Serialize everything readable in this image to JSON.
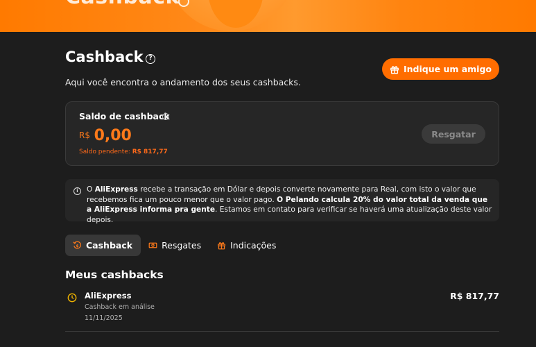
{
  "banner": {
    "title": "Cashback"
  },
  "header": {
    "title": "Cashback",
    "subtitle": "Aqui você encontra o andamento dos seus cashbacks.",
    "invite_label": "Indique um amigo"
  },
  "balance_card": {
    "label": "Saldo de cashback",
    "currency": "R$",
    "value": "0,00",
    "pending_label": "Saldo pendente:",
    "pending_value": "R$ 817,77",
    "redeem_label": "Resgatar"
  },
  "notice": {
    "p1": "O ",
    "b1": "AliExpress",
    "p2": " recebe a transação em Dólar e depois converte novamente para Real, com isto o valor que recebemos fica um pouco menor que o valor pago. ",
    "b2": "O Pelando calcula 20% do valor total da venda que a AliExpress informa pra gente",
    "p3": ". Estamos em contato para verificar se haverá uma atualização deste valor depois."
  },
  "tabs": [
    {
      "label": "Cashback",
      "active": true
    },
    {
      "label": "Resgates",
      "active": false
    },
    {
      "label": "Indicações",
      "active": false
    }
  ],
  "cashbacks": {
    "title": "Meus cashbacks",
    "items": [
      {
        "store": "AliExpress",
        "status": "Cashback em análise",
        "date": "11/11/2025",
        "amount": "R$ 817,77"
      }
    ]
  },
  "colors": {
    "accent": "#ff6d00",
    "background": "#1d1d1d",
    "card": "#262626"
  }
}
